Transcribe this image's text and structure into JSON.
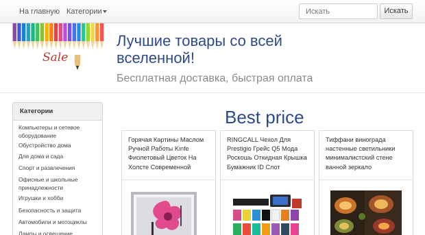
{
  "navbar": {
    "home_label": "На главную",
    "categories_label": "Категории",
    "search_placeholder": "Искать",
    "search_button": "Искать"
  },
  "header": {
    "logo_text": "Sale",
    "title": "Лучшие товары со всей вселенной!",
    "tagline": "Бесплатная доставка, быстрая оплата"
  },
  "sidebar": {
    "heading": "Категории",
    "items": [
      "Компьютеры и сетевое оборудование",
      "Обустройство дома",
      "Для дома и сада",
      "Спорт и развлечения",
      "Офисные и школьные принадлежности",
      "Игрушки и хобби",
      "Безопасность и защита",
      "Автомобили и мотоциклы",
      "Лампы и освещение"
    ]
  },
  "main": {
    "section_title": "Best price",
    "products": [
      {
        "title": "Горячая Картины Маслом Ручной Работы Kinfe Фиолетовый Цветок На Холсте Современной",
        "image": "flower-painting"
      },
      {
        "title": "RINGCALL Чехол Для Prestigio Грейс Q5 Мода Роскошь Откидная Крышка Бумажник ID Слот",
        "image": "phone-cases"
      },
      {
        "title": "Тиффани винограда настенные светильники минималистский стене ванной зеркало",
        "image": "tiffany-lamps"
      }
    ]
  },
  "colors": {
    "accent": "#2e4a8a",
    "sale": "#c0392b",
    "tagline": "#8a8a8a"
  }
}
